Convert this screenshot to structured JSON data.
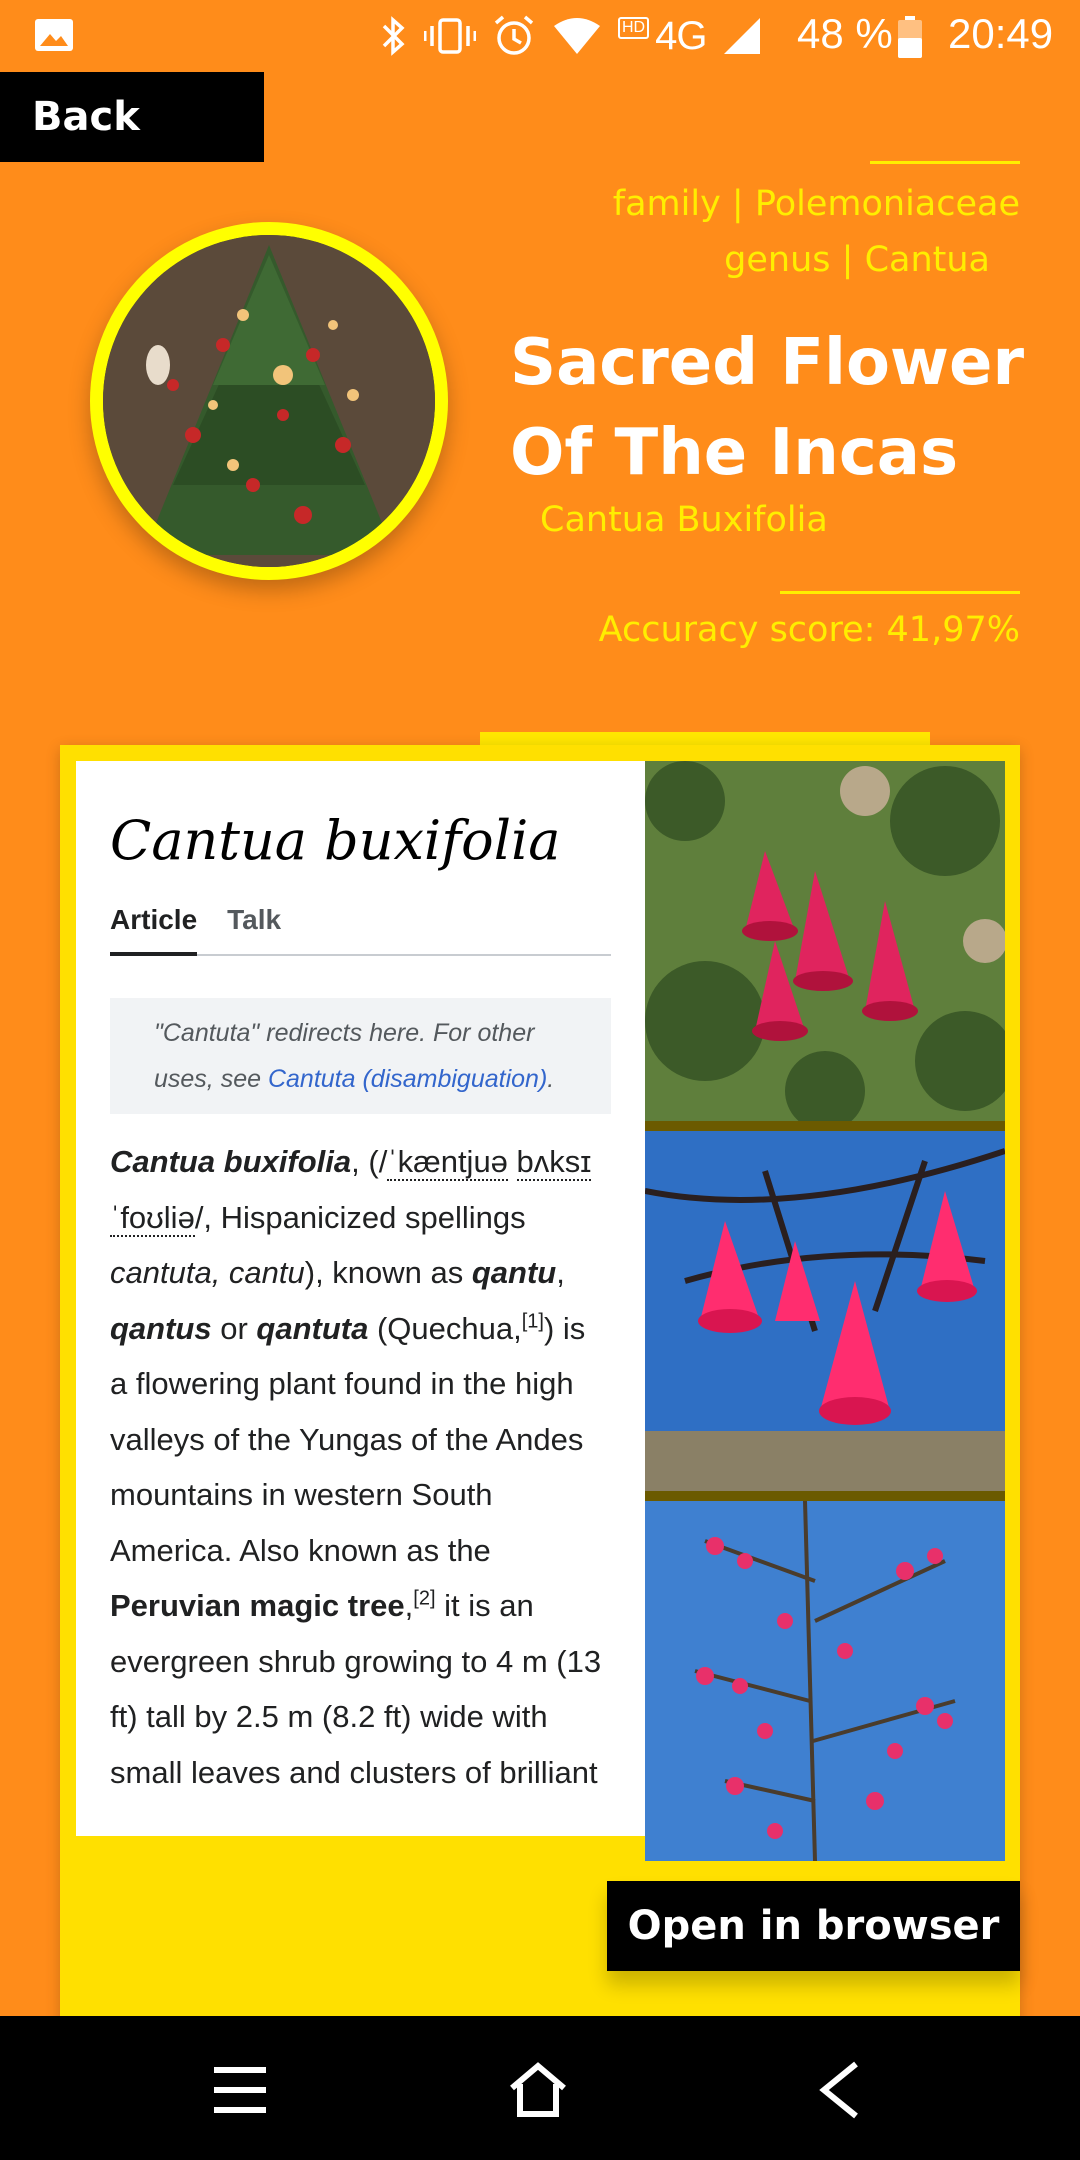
{
  "status_bar": {
    "network": "4G",
    "hd_badge": "HD",
    "battery": "48 %",
    "time": "20:49",
    "icons": [
      "gallery-icon",
      "bluetooth-icon",
      "vibrate-icon",
      "alarm-icon",
      "wifi-icon",
      "signal-icon",
      "battery-icon"
    ]
  },
  "back_label": "Back",
  "header": {
    "family": "family | Polemoniaceae",
    "genus": "genus | Cantua",
    "common_name": "Sacred Flower Of The Incas",
    "scientific_name": "Cantua Buxifolia",
    "accuracy": "Accuracy score: 41,97%"
  },
  "wiki": {
    "title": "Cantua buxifolia",
    "tabs": [
      "Article",
      "Talk"
    ],
    "hatnote_text": "\"Cantuta\" redirects here. For other uses, see ",
    "hatnote_link": "Cantuta (disambiguation)",
    "hatnote_end": ".",
    "p1_bold": "Cantua buxifolia",
    "p1_a": ", (/",
    "ipa1": "ˈkæntjuə",
    "ipa2": "bʌksɪˈfoʊliə",
    "p1_b": "/, Hispanicized spellings ",
    "p1_italic": "cantuta, cantu",
    "p1_c": "), known as ",
    "q1": "qantu",
    "q_sep": ", ",
    "q2": "qantus",
    "q_or": " or ",
    "q3": "qantuta",
    "p1_d": " (Quechua,",
    "ref1": "[1]",
    "p1_e": ") is a flowering plant found in the high valleys of the Yungas of the Andes mountains in western South America. Also known as the ",
    "magic": "Peruvian magic tree",
    "p1_f": ",",
    "ref2": "[2]",
    "p1_g": " it is an evergreen shrub growing to 4 m (13 ft) tall by 2.5 m (8.2 ft) wide with small leaves and clusters of brilliant"
  },
  "open_browser_label": "Open in browser",
  "colors": {
    "background": "#ff8c1a",
    "accent_yellow": "#ffee00",
    "card": "#ffe000"
  }
}
